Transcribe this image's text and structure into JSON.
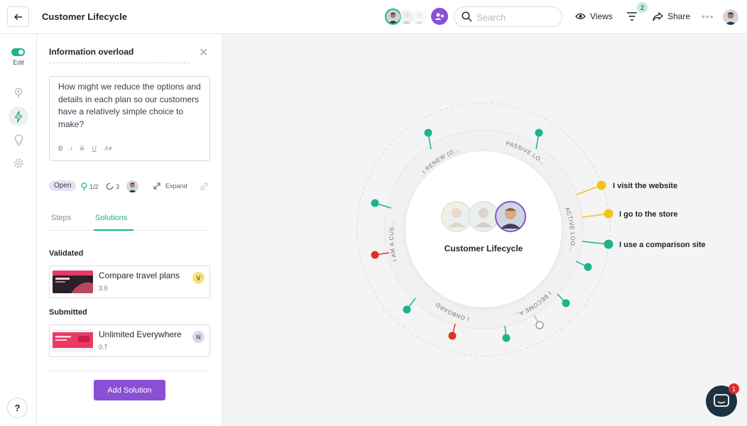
{
  "header": {
    "title": "Customer Lifecycle",
    "search_placeholder": "Search",
    "views_label": "Views",
    "filter_count": "2",
    "share_label": "Share"
  },
  "rail": {
    "edit_label": "Edit",
    "help_label": "?"
  },
  "panel": {
    "title": "Information overload",
    "description": "How might we reduce the options and details in each plan so our customers have a relatively simple choice to make?",
    "format_buttons": [
      "B",
      "i",
      "S",
      "U",
      "A▾"
    ],
    "status": "Open",
    "pins": "1/2",
    "comments": "3",
    "expand_label": "Expand",
    "tabs": [
      "Steps",
      "Solutions"
    ],
    "active_tab": "Solutions",
    "validated_title": "Validated",
    "submitted_title": "Submitted",
    "validated": [
      {
        "name": "Compare travel plans",
        "score": "3.0",
        "badge": "V",
        "badge_color": "#f7e27a"
      }
    ],
    "submitted": [
      {
        "name": "Unlimited Everywhere",
        "score": "0.7",
        "badge": "N",
        "badge_color": "#dcd8ec"
      }
    ],
    "add_solution_label": "Add Solution"
  },
  "diagram": {
    "center_title": "Customer Lifecycle",
    "stages": [
      "I RENEW (O...",
      "PASSIVE LO...",
      "ACTIVE LOO...",
      "I BECOME A...",
      "I ONBOARD",
      "I AM A CUS..."
    ],
    "touchpoints": [
      "I visit the website",
      "I go to the store",
      "I use a comparison site"
    ],
    "colors": {
      "green": "#1bb38c",
      "yellow": "#f0c419",
      "red": "#e0321f"
    }
  },
  "chat": {
    "badge": "1"
  }
}
